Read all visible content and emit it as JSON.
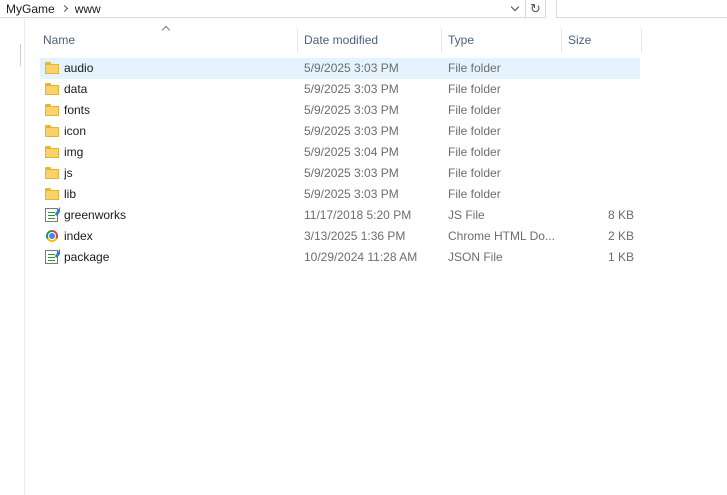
{
  "address": {
    "crumbs": [
      "MyGame",
      "www"
    ],
    "refresh_glyph": "↻"
  },
  "columns": {
    "name": "Name",
    "date": "Date modified",
    "type": "Type",
    "size": "Size"
  },
  "files": [
    {
      "name": "audio",
      "date": "5/9/2025 3:03 PM",
      "type": "File folder",
      "size": "",
      "icon": "folder-icon",
      "selected": true
    },
    {
      "name": "data",
      "date": "5/9/2025 3:03 PM",
      "type": "File folder",
      "size": "",
      "icon": "folder-icon"
    },
    {
      "name": "fonts",
      "date": "5/9/2025 3:03 PM",
      "type": "File folder",
      "size": "",
      "icon": "folder-icon"
    },
    {
      "name": "icon",
      "date": "5/9/2025 3:03 PM",
      "type": "File folder",
      "size": "",
      "icon": "folder-icon"
    },
    {
      "name": "img",
      "date": "5/9/2025 3:04 PM",
      "type": "File folder",
      "size": "",
      "icon": "folder-icon"
    },
    {
      "name": "js",
      "date": "5/9/2025 3:03 PM",
      "type": "File folder",
      "size": "",
      "icon": "folder-icon"
    },
    {
      "name": "lib",
      "date": "5/9/2025 3:03 PM",
      "type": "File folder",
      "size": "",
      "icon": "folder-icon"
    },
    {
      "name": "greenworks",
      "date": "11/17/2018 5:20 PM",
      "type": "JS File",
      "size": "8 KB",
      "icon": "script-file-icon"
    },
    {
      "name": "index",
      "date": "3/13/2025 1:36 PM",
      "type": "Chrome HTML Do...",
      "size": "2 KB",
      "icon": "chrome-html-icon"
    },
    {
      "name": "package",
      "date": "10/29/2024 11:28 AM",
      "type": "JSON File",
      "size": "1 KB",
      "icon": "script-file-icon"
    }
  ],
  "colors": {
    "selection": "#e5f3ff",
    "header_text": "#4c607a",
    "folder": "#f8d26a"
  }
}
